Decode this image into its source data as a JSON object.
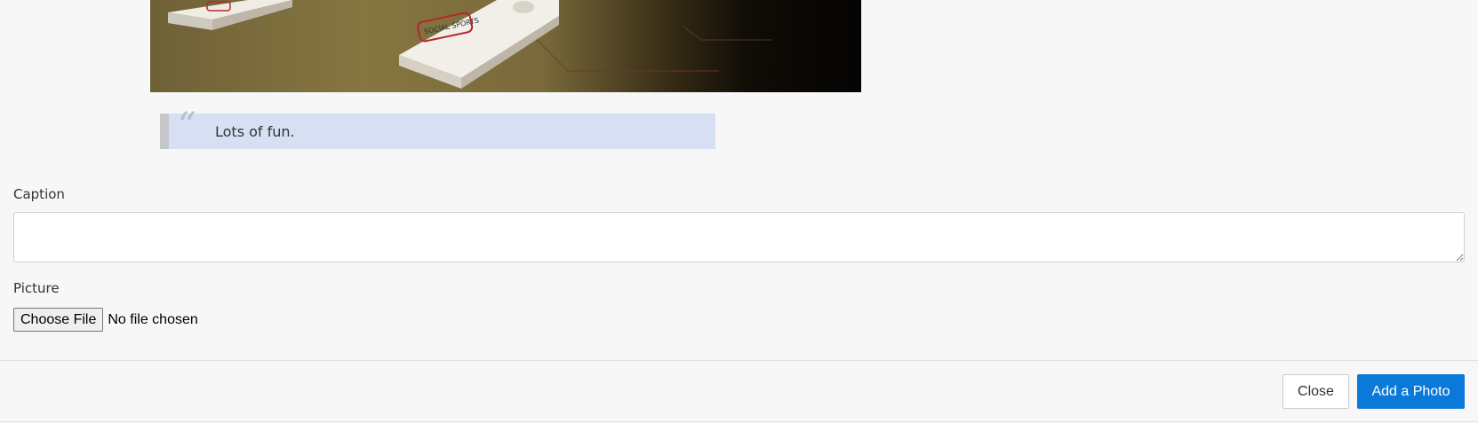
{
  "photo": {
    "alt": "Cornhole boards on a floor",
    "board_logo_text": "SOCIAL SPORTS"
  },
  "quote": {
    "mark": "“",
    "text": "Lots of fun."
  },
  "form": {
    "caption_label": "Caption",
    "caption_value": "",
    "picture_label": "Picture",
    "choose_file_label": "Choose File",
    "no_file_text": "No file chosen"
  },
  "footer": {
    "close_label": "Close",
    "add_photo_label": "Add a Photo"
  },
  "colors": {
    "primary": "#0b79d9",
    "quote_bg": "#d7e0f3",
    "quote_border": "#c5c7ca"
  }
}
